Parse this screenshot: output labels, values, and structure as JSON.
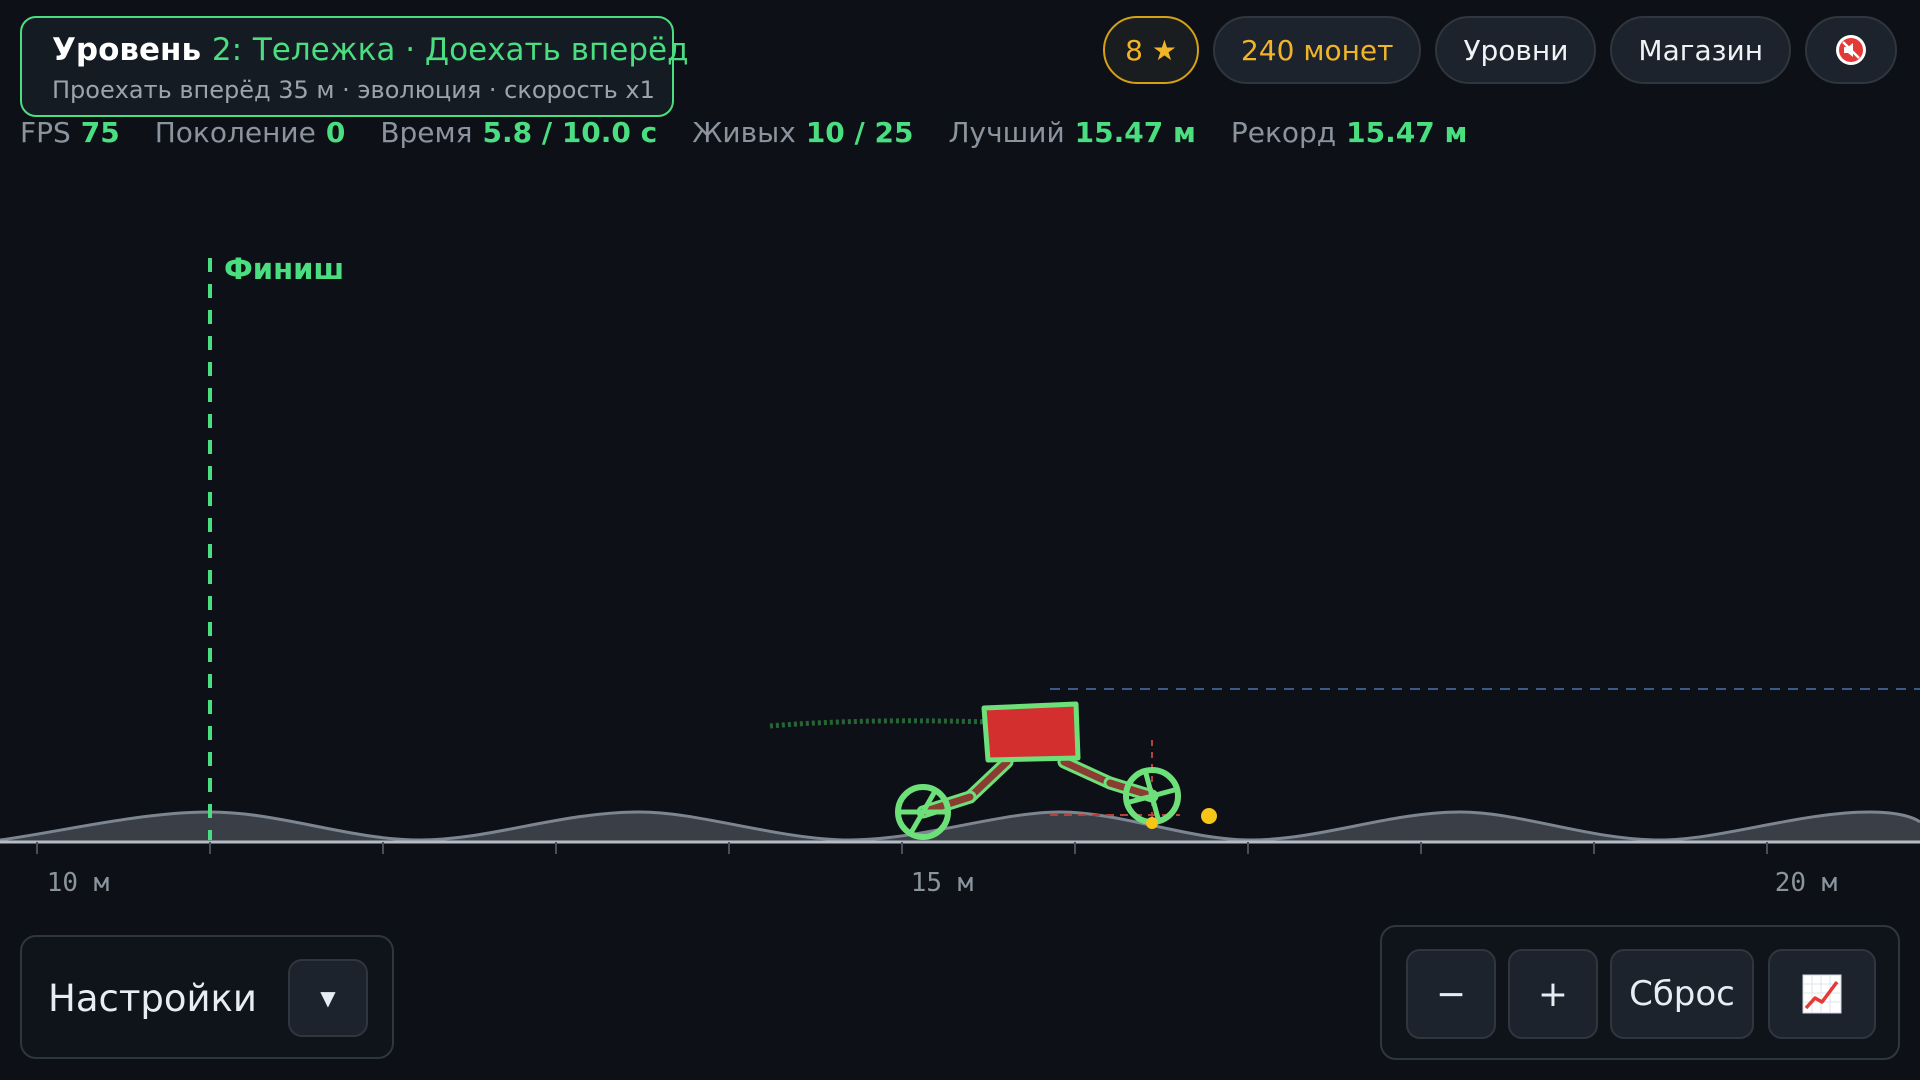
{
  "level": {
    "prefix": "Уровень",
    "number": "2:",
    "name": "Тележка · Доехать вперёд",
    "subtitle": "Проехать вперёд 35 м · эволюция · скорость x1"
  },
  "top_bar": {
    "stars_label": "8 ★",
    "coins_label": "240 монет",
    "levels_button": "Уровни",
    "shop_button": "Магазин",
    "mute_icon": "speaker-muted-icon"
  },
  "stats": {
    "fps_label": "FPS",
    "fps_value": "75",
    "generation_label": "Поколение",
    "generation_value": "0",
    "time_label": "Время",
    "time_value": "5.8 / 10.0 с",
    "alive_label": "Живых",
    "alive_value": "10 / 25",
    "best_label": "Лучший",
    "best_value": "15.47 м",
    "record_label": "Рекорд",
    "record_value": "15.47 м"
  },
  "game": {
    "finish_label": "Финиш",
    "distance_ticks": [
      "10 м",
      "15 м",
      "20 м"
    ],
    "colors": {
      "finish": "#4ade80",
      "body": "#d32f2f",
      "outline": "#6ee07a",
      "leg": "#8a3b32",
      "marker": "#f5c518",
      "ground": "#3a3f47"
    }
  },
  "settings": {
    "label": "Настройки",
    "toggle_icon": "▼"
  },
  "zoom": {
    "minus": "−",
    "plus": "+",
    "reset": "Сброс",
    "chart_icon": "chart-icon"
  }
}
